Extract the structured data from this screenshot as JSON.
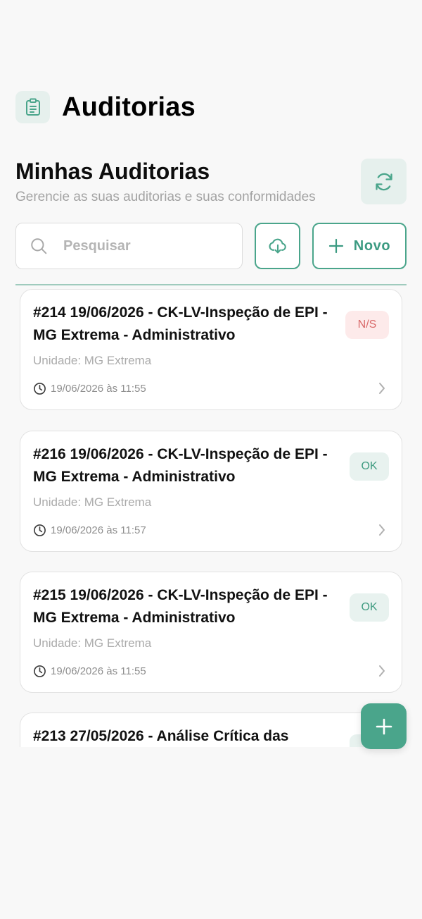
{
  "app": {
    "title": "Auditorias",
    "icon": "clipboard-icon"
  },
  "section": {
    "title": "Minhas Auditorias",
    "subtitle": "Gerencie as suas auditorias e suas conformidades"
  },
  "search": {
    "placeholder": "Pesquisar",
    "value": ""
  },
  "actions": {
    "new_label": "Novo"
  },
  "audits": [
    {
      "title": "#214 19/06/2026 - CK-LV-Inspeção de EPI - MG Extrema - Administrativo",
      "unit": "Unidade: MG Extrema",
      "datetime": "19/06/2026 às 11:55",
      "status": "N/S"
    },
    {
      "title": "#216 19/06/2026 - CK-LV-Inspeção de EPI - MG Extrema - Administrativo",
      "unit": "Unidade: MG Extrema",
      "datetime": "19/06/2026 às 11:57",
      "status": "OK"
    },
    {
      "title": "#215 19/06/2026 - CK-LV-Inspeção de EPI - MG Extrema - Administrativo",
      "unit": "Unidade: MG Extrema",
      "datetime": "19/06/2026 às 11:55",
      "status": "OK"
    },
    {
      "title": "#213 27/05/2026 - Análise Crítica das",
      "unit": "",
      "datetime": "",
      "status": ""
    }
  ],
  "colors": {
    "accent": "#4aa58b",
    "accent_light": "#e6f0ed",
    "status_ns_bg": "#fdeaea",
    "status_ns_text": "#d96a6a",
    "status_ok_bg": "#e8f2ef",
    "status_ok_text": "#3f9b80"
  }
}
